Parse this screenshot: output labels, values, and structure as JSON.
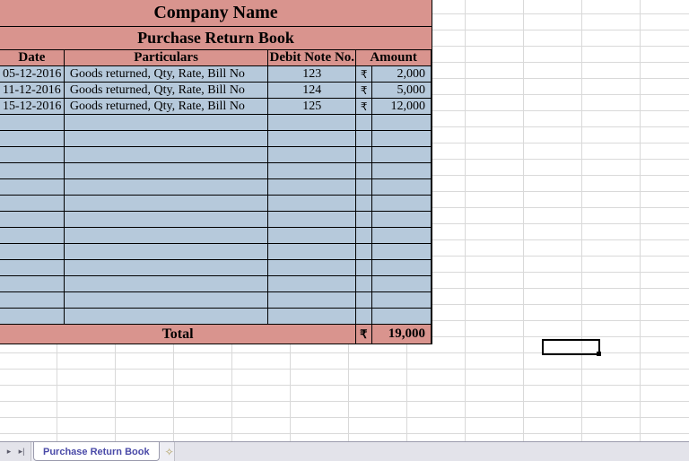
{
  "header": {
    "company": "Company Name",
    "title": "Purchase Return Book"
  },
  "columns": {
    "date": "Date",
    "particulars": "Particulars",
    "debit_note": "Debit Note No.",
    "amount": "Amount"
  },
  "currency_symbol": "₹",
  "rows": [
    {
      "date": "05-12-2016",
      "particulars": "Goods returned, Qty, Rate, Bill No",
      "debit_note": "123",
      "amount": "2,000"
    },
    {
      "date": "11-12-2016",
      "particulars": "Goods returned, Qty, Rate, Bill No",
      "debit_note": "124",
      "amount": "5,000"
    },
    {
      "date": "15-12-2016",
      "particulars": "Goods returned, Qty, Rate, Bill No",
      "debit_note": "125",
      "amount": "12,000"
    },
    {
      "date": "",
      "particulars": "",
      "debit_note": "",
      "amount": ""
    },
    {
      "date": "",
      "particulars": "",
      "debit_note": "",
      "amount": ""
    },
    {
      "date": "",
      "particulars": "",
      "debit_note": "",
      "amount": ""
    },
    {
      "date": "",
      "particulars": "",
      "debit_note": "",
      "amount": ""
    },
    {
      "date": "",
      "particulars": "",
      "debit_note": "",
      "amount": ""
    },
    {
      "date": "",
      "particulars": "",
      "debit_note": "",
      "amount": ""
    },
    {
      "date": "",
      "particulars": "",
      "debit_note": "",
      "amount": ""
    },
    {
      "date": "",
      "particulars": "",
      "debit_note": "",
      "amount": ""
    },
    {
      "date": "",
      "particulars": "",
      "debit_note": "",
      "amount": ""
    },
    {
      "date": "",
      "particulars": "",
      "debit_note": "",
      "amount": ""
    },
    {
      "date": "",
      "particulars": "",
      "debit_note": "",
      "amount": ""
    },
    {
      "date": "",
      "particulars": "",
      "debit_note": "",
      "amount": ""
    },
    {
      "date": "",
      "particulars": "",
      "debit_note": "",
      "amount": ""
    }
  ],
  "total": {
    "label": "Total",
    "amount": "19,000"
  },
  "sheet_tab": "Purchase Return Book"
}
